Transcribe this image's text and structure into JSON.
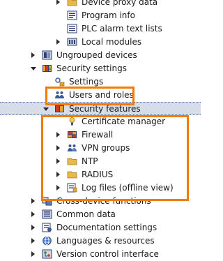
{
  "tree": [
    {
      "label": "Device proxy data",
      "level": 4,
      "expander": "right",
      "icon": "folder-icon"
    },
    {
      "label": "Program info",
      "level": 4,
      "expander": "none",
      "icon": "program-info-icon"
    },
    {
      "label": "PLC alarm text lists",
      "level": 4,
      "expander": "none",
      "icon": "alarm-text-list-icon"
    },
    {
      "label": "Local modules",
      "level": 4,
      "expander": "right",
      "icon": "local-modules-icon"
    },
    {
      "label": "Ungrouped devices",
      "level": 2,
      "expander": "right",
      "icon": "ungrouped-devices-icon"
    },
    {
      "label": "Security settings",
      "level": 2,
      "expander": "down",
      "icon": "security-settings-icon"
    },
    {
      "label": "Settings",
      "level": 3,
      "expander": "none",
      "icon": "settings-icon"
    },
    {
      "label": "Users and roles",
      "level": 3,
      "expander": "none",
      "icon": "users-roles-icon"
    },
    {
      "label": "Security features",
      "level": 3,
      "expander": "down",
      "icon": "security-features-icon",
      "selected": true
    },
    {
      "label": "Certificate manager",
      "level": 4,
      "expander": "none",
      "icon": "certificate-manager-icon"
    },
    {
      "label": "Firewall",
      "level": 4,
      "expander": "right",
      "icon": "firewall-icon"
    },
    {
      "label": "VPN groups",
      "level": 4,
      "expander": "right",
      "icon": "vpn-groups-icon"
    },
    {
      "label": "NTP",
      "level": 4,
      "expander": "right",
      "icon": "ntp-icon"
    },
    {
      "label": "RADIUS",
      "level": 4,
      "expander": "right",
      "icon": "radius-icon"
    },
    {
      "label": "Log files (offline view)",
      "level": 4,
      "expander": "right",
      "icon": "log-files-icon"
    },
    {
      "label": "Cross-device functions",
      "level": 2,
      "expander": "right",
      "icon": "cross-device-functions-icon"
    },
    {
      "label": "Common data",
      "level": 2,
      "expander": "right",
      "icon": "common-data-icon"
    },
    {
      "label": "Documentation settings",
      "level": 2,
      "expander": "right",
      "icon": "documentation-settings-icon"
    },
    {
      "label": "Languages & resources",
      "level": 2,
      "expander": "right",
      "icon": "languages-resources-icon"
    },
    {
      "label": "Version control interface",
      "level": 2,
      "expander": "right",
      "icon": "version-control-icon"
    }
  ],
  "highlights": [
    {
      "name": "highlight-users-and-roles",
      "color": "#f07d00"
    },
    {
      "name": "highlight-security-features-children",
      "color": "#f07d00"
    }
  ]
}
